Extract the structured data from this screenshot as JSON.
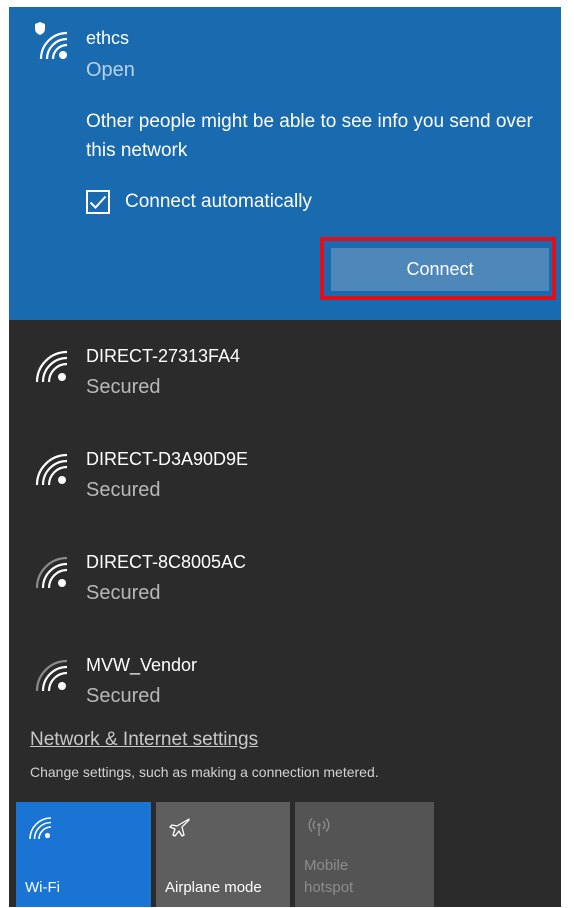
{
  "selected_network": {
    "name": "ethcs",
    "status": "Open",
    "warning": "Other people might be able to see info you send over this network",
    "connect_automatically_label": "Connect automatically",
    "connect_automatically_checked": true,
    "connect_button_label": "Connect",
    "icon": "wifi-shield-icon"
  },
  "networks": [
    {
      "name": "DIRECT-27313FA4",
      "status": "Secured",
      "icon": "wifi-signal-icon"
    },
    {
      "name": "DIRECT-D3A90D9E",
      "status": "Secured",
      "icon": "wifi-signal-icon"
    },
    {
      "name": "DIRECT-8C8005AC",
      "status": "Secured",
      "icon": "wifi-signal-icon"
    },
    {
      "name": "MVW_Vendor",
      "status": "Secured",
      "icon": "wifi-signal-icon"
    }
  ],
  "settings": {
    "link_label": "Network & Internet settings",
    "description": "Change settings, such as making a connection metered."
  },
  "quick_actions": [
    {
      "label": "Wi-Fi",
      "icon": "wifi-icon",
      "state": "on"
    },
    {
      "label": "Airplane mode",
      "icon": "airplane-icon",
      "state": "off"
    },
    {
      "label_line1": "Mobile",
      "label_line2": "hotspot",
      "icon": "hotspot-icon",
      "state": "disabled"
    }
  ],
  "colors": {
    "selected_bg": "#1a6ab0",
    "panel_bg": "#2b2b2b",
    "connect_button": "#4e87ba",
    "highlight_border": "#e10f1a",
    "wifi_tile": "#1a74d3"
  }
}
